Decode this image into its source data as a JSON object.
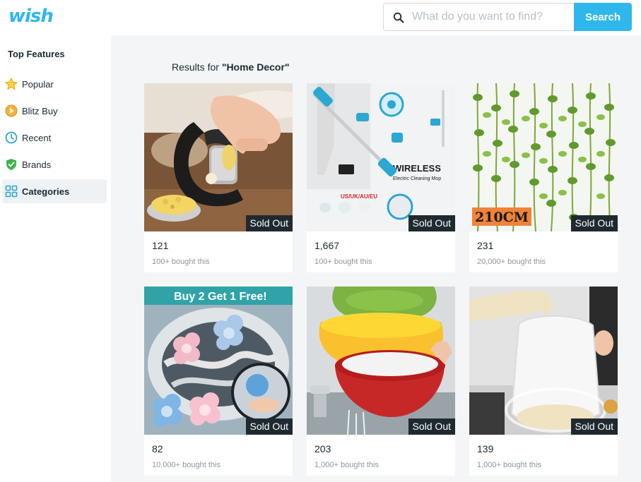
{
  "header": {
    "logo": "wish",
    "search_placeholder": "What do you want to find?",
    "search_value": "",
    "search_label": "Search"
  },
  "sidebar": {
    "title": "Top Features",
    "items": [
      {
        "label": "Popular",
        "icon": "star-icon"
      },
      {
        "label": "Blitz Buy",
        "icon": "blitz-buy-icon"
      },
      {
        "label": "Recent",
        "icon": "clock-icon"
      },
      {
        "label": "Brands",
        "icon": "shield-check-icon"
      },
      {
        "label": "Categories",
        "icon": "grid-icon",
        "active": true
      }
    ]
  },
  "results": {
    "prefix": "Results for ",
    "query": "\"Home Decor\""
  },
  "products": [
    {
      "price": "121",
      "bought": "100+ bought this",
      "badge": "Sold Out",
      "image": "garlic-press"
    },
    {
      "price": "1,667",
      "bought": "100+ bought this",
      "badge": "Sold Out",
      "image": "wireless-mop",
      "image_text": [
        "WIRELESS",
        "Electric Cleaning Mop",
        "US/UK/AU/EU"
      ]
    },
    {
      "price": "231",
      "bought": "20,000+ bought this",
      "badge": "Sold Out",
      "image": "ivy-vines",
      "image_text": [
        "210CM"
      ]
    },
    {
      "price": "82",
      "bought": "10,000+ bought this",
      "badge": "Sold Out",
      "image": "laundry-filter",
      "image_text": [
        "Buy 2 Get 1 Free!"
      ]
    },
    {
      "price": "203",
      "bought": "1,000+ bought this",
      "badge": "Sold Out",
      "image": "colander-bowls"
    },
    {
      "price": "139",
      "bought": "1,000+ bought this",
      "badge": "Sold Out",
      "image": "milk-bag"
    }
  ],
  "colors": {
    "brand": "#2fb7ec",
    "text": "#192a32",
    "muted": "#8a97a0",
    "badge_bg": "#1f2a30",
    "page_bg": "#f4f5f7"
  }
}
